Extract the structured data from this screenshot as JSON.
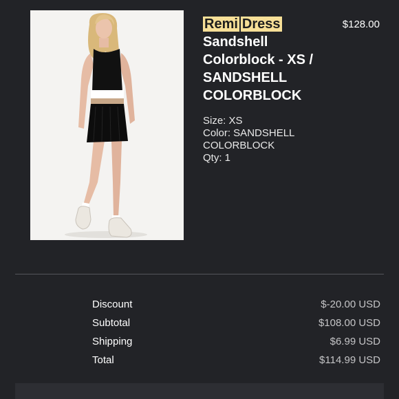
{
  "product": {
    "title_word_1": "Remi",
    "title_word_2": "Dress",
    "title_rest": "Sandshell Colorblock - XS / SANDSHELL COLORBLOCK",
    "price": "$128.00",
    "size": "Size: XS",
    "color": "Color: SANDSHELL COLORBLOCK",
    "qty": "Qty: 1",
    "highlight_color": "#f7df97"
  },
  "summary": [
    {
      "label": "Discount",
      "value": "$-20.00 USD"
    },
    {
      "label": "Subtotal",
      "value": "$108.00 USD"
    },
    {
      "label": "Shipping",
      "value": "$6.99 USD"
    },
    {
      "label": "Total",
      "value": "$114.99 USD"
    }
  ],
  "colors": {
    "background": "#222327",
    "text": "#ffffff",
    "muted": "#c4c4c6"
  }
}
